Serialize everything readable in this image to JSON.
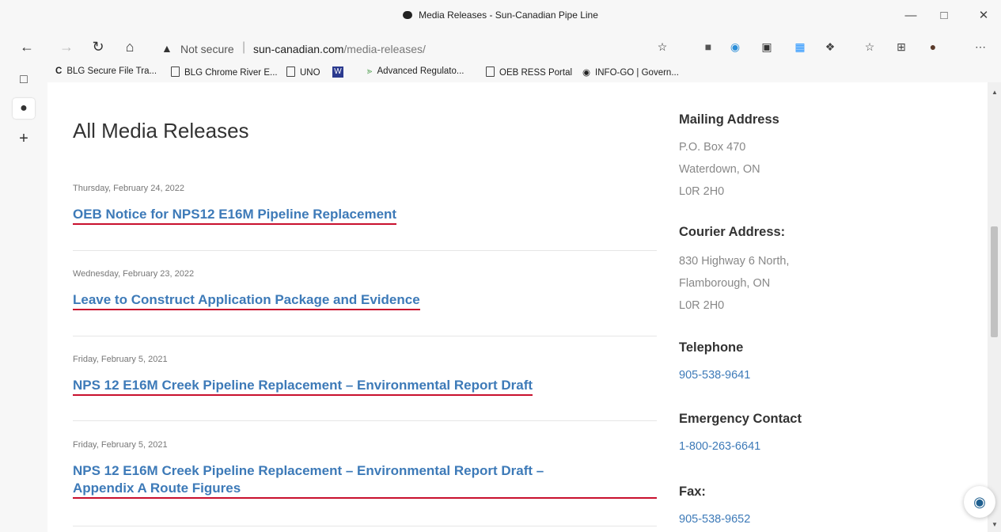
{
  "window": {
    "title": "Media Releases - Sun-Canadian Pipe Line"
  },
  "address_bar": {
    "security": "Not secure",
    "url_domain": "sun-canadian.com",
    "url_path": "/media-releases/"
  },
  "bookmarks": [
    "BLG Secure File Tra...",
    "BLG Chrome River E...",
    "UNO",
    "Advanced Regulato...",
    "OEB RESS Portal",
    "INFO-GO | Govern..."
  ],
  "main": {
    "title": "All Media Releases",
    "releases": [
      {
        "date": "Thursday, February 24, 2022",
        "title": "OEB Notice for NPS12 E16M Pipeline Replacement"
      },
      {
        "date": "Wednesday, February 23, 2022",
        "title": "Leave to Construct Application Package and Evidence"
      },
      {
        "date": "Friday, February 5, 2021",
        "title": "NPS 12 E16M Creek Pipeline Replacement – Environmental Report Draft"
      },
      {
        "date": "Friday, February 5, 2021",
        "title_line1": "NPS 12 E16M Creek Pipeline Replacement – Environmental Report Draft –",
        "title_line2": "Appendix A Route Figures"
      }
    ]
  },
  "contact": {
    "mailing_heading": "Mailing Address",
    "mailing_lines": [
      "P.O. Box 470",
      "Waterdown, ON",
      "L0R 2H0"
    ],
    "courier_heading": "Courier Address:",
    "courier_lines": [
      "830 Highway 6 North,",
      "Flamborough, ON",
      "L0R 2H0"
    ],
    "telephone_heading": "Telephone",
    "telephone": "905-538-9641",
    "emergency_heading": "Emergency Contact",
    "emergency": "1-800-263-6641",
    "fax_heading": "Fax:",
    "fax": "905-538-9652"
  },
  "colors": {
    "link": "#3d7ab8",
    "underline": "#c8102e"
  }
}
